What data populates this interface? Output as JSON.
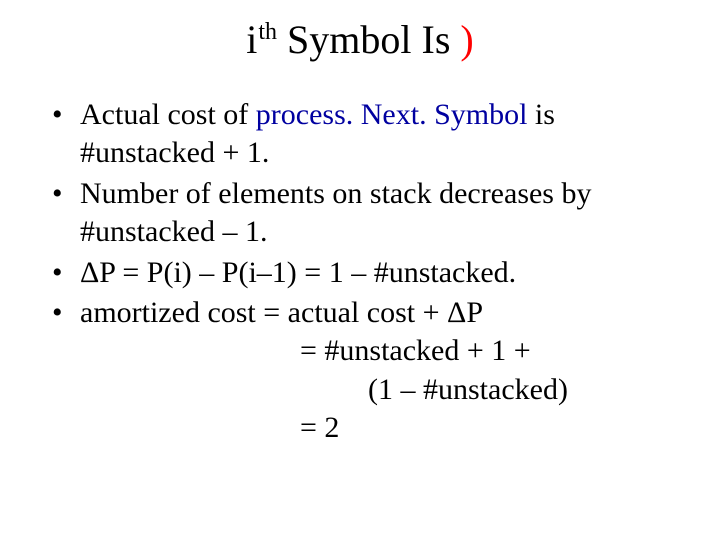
{
  "title": {
    "i": "i",
    "th": "th",
    "middle": " Symbol Is ",
    "paren": ")"
  },
  "bullets": {
    "b1a": "Actual cost of ",
    "b1fn": "process. Next. Symbol",
    "b1b": " is #unstacked + 1.",
    "b2": "Number of elements on stack decreases by #unstacked – 1.",
    "b3": "ΔP = P(i) – P(i–1) = 1 – #unstacked.",
    "b4_l1": "amortized cost = actual cost + ΔP",
    "b4_l2": "= #unstacked + 1 +",
    "b4_l3": "(1 – #unstacked)",
    "b4_l4": "= 2"
  }
}
